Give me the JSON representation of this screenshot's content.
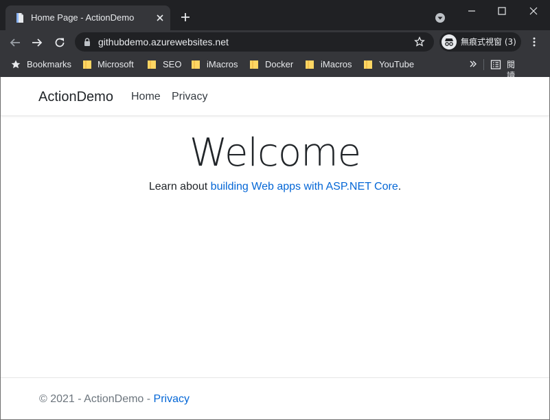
{
  "browser": {
    "tab_title": "Home Page - ActionDemo",
    "url": "githubdemo.azurewebsites.net",
    "incognito_label": "無痕式視窗 (3)",
    "bookmarks": [
      {
        "label": "Bookmarks",
        "icon": "star-icon"
      },
      {
        "label": "Microsoft",
        "icon": "folder-icon"
      },
      {
        "label": "SEO",
        "icon": "folder-icon"
      },
      {
        "label": "iMacros",
        "icon": "folder-icon"
      },
      {
        "label": "Docker",
        "icon": "folder-icon"
      },
      {
        "label": "iMacros",
        "icon": "folder-icon"
      },
      {
        "label": "YouTube",
        "icon": "folder-icon"
      }
    ],
    "reading_list_label": "閱讀清單",
    "colors": {
      "titlebar": "#202124",
      "toolbar": "#35363a",
      "text": "#e8eaed",
      "folder": "#fdd663"
    }
  },
  "site": {
    "brand": "ActionDemo",
    "nav": {
      "home": "Home",
      "privacy": "Privacy"
    },
    "hero": {
      "title": "Welcome",
      "prefix": "Learn about ",
      "link_text": "building Web apps with ASP.NET Core",
      "suffix": "."
    },
    "footer": {
      "text": "© 2021 - ActionDemo - ",
      "link_text": "Privacy"
    },
    "colors": {
      "link": "#0366d6",
      "text": "#212529",
      "muted": "#6c757d"
    }
  }
}
